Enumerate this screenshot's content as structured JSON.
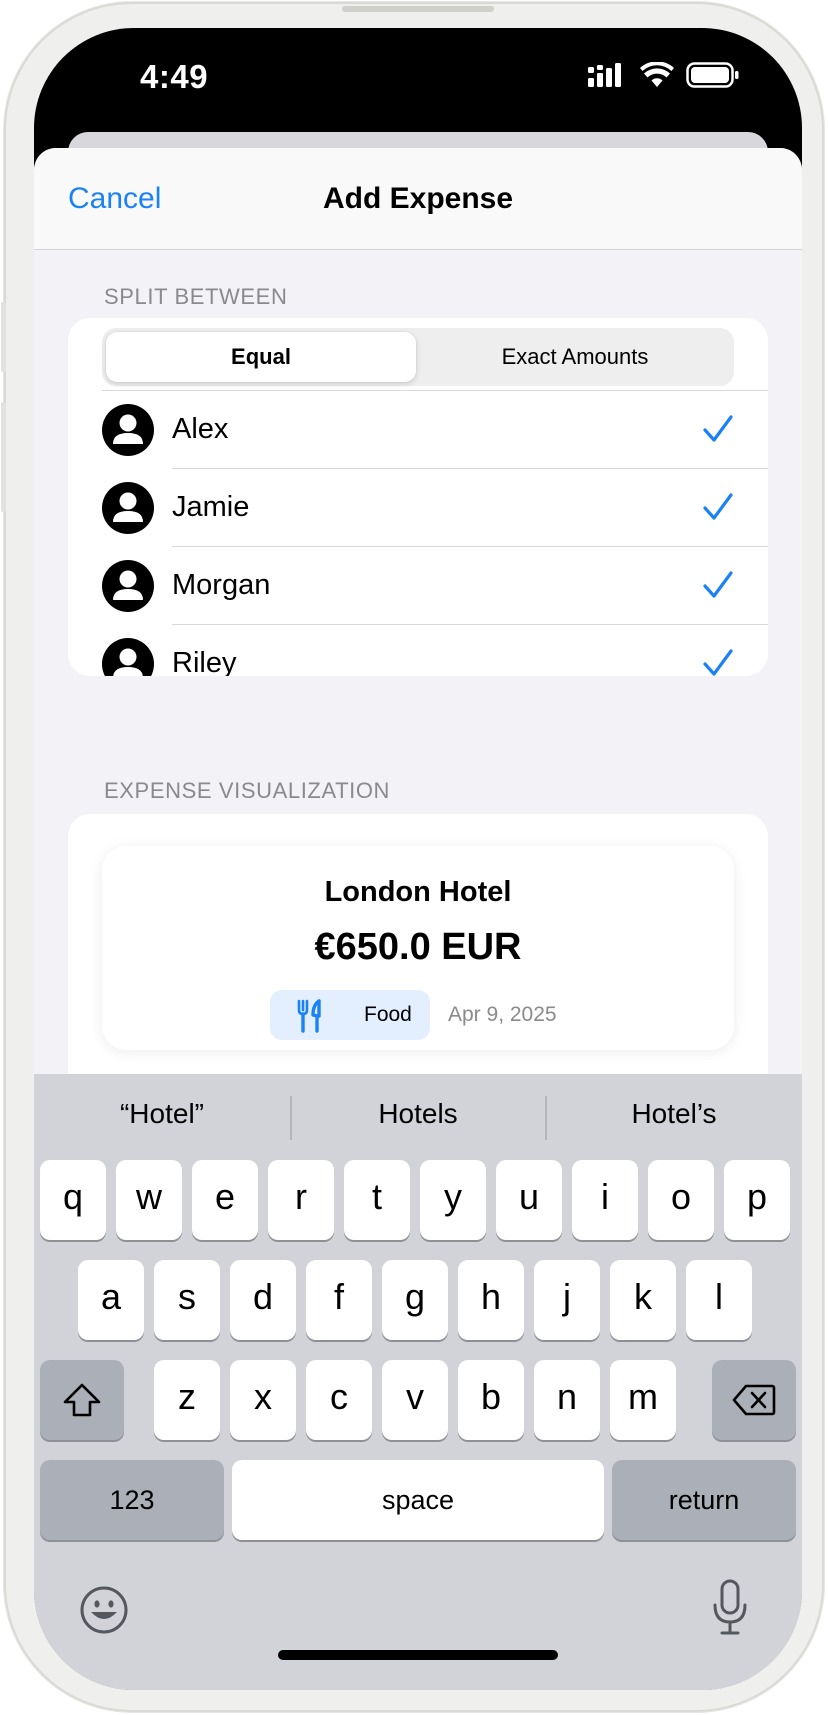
{
  "status_bar": {
    "time": "4:49"
  },
  "nav": {
    "cancel_label": "Cancel",
    "title": "Add Expense"
  },
  "split_section": {
    "header": "SPLIT BETWEEN",
    "modes": [
      "Equal",
      "Exact Amounts"
    ],
    "selected_mode": "Equal",
    "people": [
      {
        "name": "Alex",
        "checked": true
      },
      {
        "name": "Jamie",
        "checked": true
      },
      {
        "name": "Morgan",
        "checked": true
      },
      {
        "name": "Riley",
        "checked": true
      }
    ]
  },
  "visualization_section": {
    "header": "EXPENSE VISUALIZATION",
    "title": "London Hotel",
    "amount": "€650.0 EUR",
    "category": "Food",
    "category_icon": "fork-knife-icon",
    "date": "Apr 9, 2025"
  },
  "keyboard": {
    "suggestions": [
      "“Hotel”",
      "Hotels",
      "Hotel’s"
    ],
    "row1": [
      "q",
      "w",
      "e",
      "r",
      "t",
      "y",
      "u",
      "i",
      "o",
      "p"
    ],
    "row2": [
      "a",
      "s",
      "d",
      "f",
      "g",
      "h",
      "j",
      "k",
      "l"
    ],
    "row3": [
      "z",
      "x",
      "c",
      "v",
      "b",
      "n",
      "m"
    ],
    "numbers_label": "123",
    "space_label": "space",
    "return_label": "return"
  },
  "colors": {
    "accent": "#1a82f5",
    "sheet_bg": "#f2f2f7",
    "keyboard_bg": "#d1d3d9",
    "badge_bg": "#e3efff"
  }
}
